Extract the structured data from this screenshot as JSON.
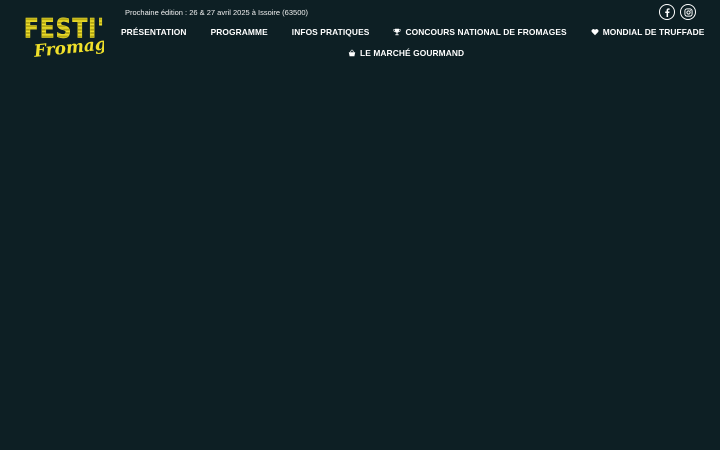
{
  "brand": {
    "logo_text_top": "FESTI'",
    "logo_text_bottom": "Fromage",
    "logo_color": "#f0e02a"
  },
  "header": {
    "edition_text": "Prochaine édition : 26 & 27 avril 2025 à Issoire (63500)"
  },
  "social": [
    {
      "name": "facebook",
      "icon": "facebook-icon"
    },
    {
      "name": "instagram",
      "icon": "instagram-icon"
    }
  ],
  "nav": {
    "items": [
      {
        "label": "PRÉSENTATION",
        "icon": null
      },
      {
        "label": "PROGRAMME",
        "icon": null
      },
      {
        "label": "INFOS PRATIQUES",
        "icon": null
      },
      {
        "label": "CONCOURS NATIONAL DE FROMAGES",
        "icon": "trophy-icon"
      },
      {
        "label": "MONDIAL DE TRUFFADE",
        "icon": "heart-icon"
      },
      {
        "label": "LE MARCHÉ GOURMAND",
        "icon": "basket-icon"
      }
    ]
  },
  "colors": {
    "background": "#0d1f24",
    "text": "#ffffff",
    "accent": "#f0e02a"
  }
}
